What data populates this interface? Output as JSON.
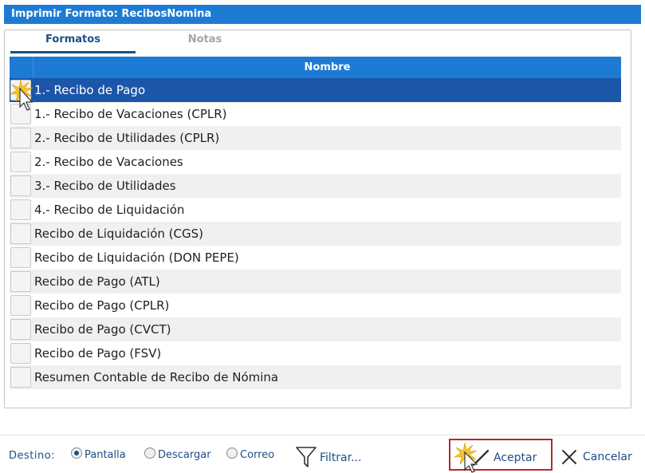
{
  "window": {
    "title": "Imprimir Formato: RecibosNomina"
  },
  "tabs": [
    {
      "label": "Formatos",
      "active": true
    },
    {
      "label": "Notas",
      "active": false
    }
  ],
  "grid": {
    "column_header": "Nombre",
    "rows": [
      "1.- Recibo de Pago",
      "1.- Recibo de Vacaciones (CPLR)",
      "2.- Recibo de Utilidades (CPLR)",
      "2.- Recibo de Vacaciones",
      "3.- Recibo de Utilidades",
      "4.- Recibo de Liquidación",
      "Recibo de Liquidación (CGS)",
      "Recibo de Liquidación (DON PEPE)",
      "Recibo de Pago (ATL)",
      "Recibo de Pago (CPLR)",
      "Recibo de Pago (CVCT)",
      "Recibo de Pago (FSV)",
      "Resumen Contable de Recibo de Nómina"
    ],
    "selected_index": 0
  },
  "footer": {
    "destination_label": "Destino:",
    "options": [
      {
        "label": "Pantalla",
        "checked": true
      },
      {
        "label": "Descargar",
        "checked": false
      },
      {
        "label": "Correo",
        "checked": false
      }
    ],
    "filter_label": "Filtrar...",
    "accept_label": "Aceptar",
    "cancel_label": "Cancelar"
  },
  "colors": {
    "title_bar": "#1e7bd3",
    "selected_row": "#1c56a8",
    "link_text": "#1c4f86",
    "accept_border": "#b8282b"
  }
}
